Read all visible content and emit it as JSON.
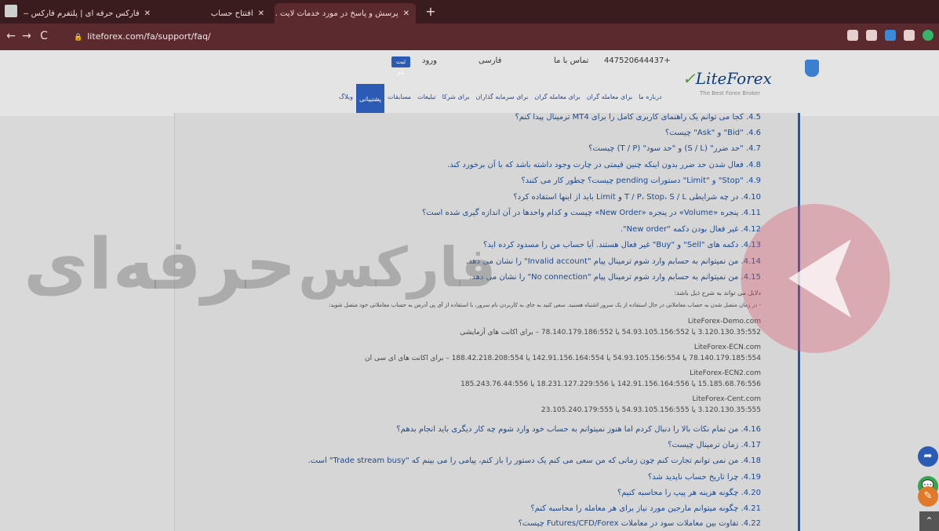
{
  "browser": {
    "tabs": [
      {
        "label": "فارکس حرفه ای | پلتفرم فارکس — ..."
      },
      {
        "label": "افتتاح حساب"
      },
      {
        "label": "پرسش و پاسخ در مورد خدمات لایت ..."
      }
    ],
    "new_tab": "+",
    "url": "liteforex.com/fa/support/faq/",
    "nav": {
      "back": "←",
      "forward": "→",
      "reload": "C",
      "lock": "🔒"
    }
  },
  "header": {
    "logo": "LiteForex",
    "logo_mark": "✓",
    "logo_sub": "The Best Forex Broker",
    "phone": "+447520644437",
    "callback": "تماس با ما",
    "language": "فارسی",
    "login": "ورود",
    "signup": "ثبت نام",
    "menu": [
      "درباره ما",
      "برای معامله گران",
      "برای معامله گران",
      "برای سرمایه گذاران",
      "برای شرکا",
      "تبلیغات",
      "مسابقات",
      "پشتیبانی",
      "وبلاگ"
    ],
    "active_menu_index": 7
  },
  "faq": {
    "items": [
      "4.5. کجا می توانم یک راهنمای کاربری کامل را برای MT4 ترمینال پیدا کنم؟",
      "4.6. \"Bid\" و \"Ask\" چیست؟",
      "4.7. \"حد ضرر\" (S / L) و \"حد سود\" (T / P) چیست؟",
      "4.8. فعال شدن حد ضرر بدون اینکه چنین قیمتی در چارت وجود داشته باشد که با آن برخورد کند.",
      "4.9. \"Stop\" و \"Limit\" دستورات pending چیست؟ چطور کار می کنند؟",
      "4.10. در چه شرایطی T / P، Stop، S / L و Limit باید از اینها استفاده کرد؟",
      "4.11. پنجره «Volume» در پنجره «New Order» چیست و کدام واحدها در آن اندازه گیری شده است؟",
      "4.12. غیر فعال بودن دکمه \"New order\".",
      "4.13. دکمه های \"Sell\" و \"Buy\" غیر فعال هستند. آیا حساب من را مسدود کرده اید؟",
      "4.14. من نمیتوانم به حسابم وارد شوم ترمینال پیام \"Invalid account\" را نشان می دهد.",
      "4.15. من نمیتوانم به حسابم وارد شوم ترمینال پیام \"No connection\" را نشان می دهد."
    ],
    "reasons_intro": "دلایل می تواند به شرح ذیل باشد:",
    "reason_1": "- در زمان متصل شدن به حساب معاملاتی در حال استفاده از یک سرور اشتباه هستید. سعی کنید به جای به کاربردن نام سرور، با استفاده از آی پی آدرس به حساب معاملاتی خود متصل شوید:",
    "servers": [
      {
        "name": "LiteForex-Demo.com",
        "ips": "3.120.130.35:552 یا 54.93.105.156:552 یا 78.140.179.186:552 – برای اکانت های آزمایشی"
      },
      {
        "name": "LiteForex-ECN.com",
        "ips": "78.140.179.185:554 یا 54.93.105.156:554 یا 142.91.156.164:554 یا 188.42.218.208:554 – برای اکانت های ای سی ان"
      },
      {
        "name": "LiteForex-ECN2.com",
        "ips": "15.185.68.76:556 یا 142.91.156.164:556 یا 18.231.127.229:556 یا 185.243.76.44:556"
      },
      {
        "name": "LiteForex-Cent.com",
        "ips": "3.120.130.35:555 یا 54.93.105.156:555 یا 23.105.240.179:555"
      }
    ],
    "items_after": [
      "4.16. من تمام نکات بالا را دنبال کردم اما هنوز نمیتوانم به حساب خود وارد شوم چه کار دیگری باید انجام بدهم؟",
      "4.17. زمان ترمینال چیست؟",
      "4.18. من نمی توانم تجارت کنم چون زمانی که من سعی می کنم یک دستور را باز کنم، پیامی را می بینم که \"Trade stream busy\" است.",
      "4.19. چرا تاریخ حساب ناپدید شد؟",
      "4.20. چگونه هزینه هر پیپ را محاسبه کنیم؟",
      "4.21. چگونه میتوانم مارجین مورد نیاز برای هر معامله را محاسبه کنم؟",
      "4.22. تفاوت بین معاملات سود در معاملات Futures/CFD/Forex چیست؟"
    ]
  },
  "watermark": {
    "line1": "فارکس",
    "line2": "حرفه‌ای"
  },
  "floating": {
    "share": "➦",
    "chat": "💬",
    "edit": "✎",
    "scroll_top": "⌃"
  },
  "colors": {
    "tabbar": "#3a1c1f",
    "toolbar": "#5a2a2e",
    "accent": "#2b5bb5",
    "link": "#1b4a90",
    "brand_red": "#d9536a"
  }
}
